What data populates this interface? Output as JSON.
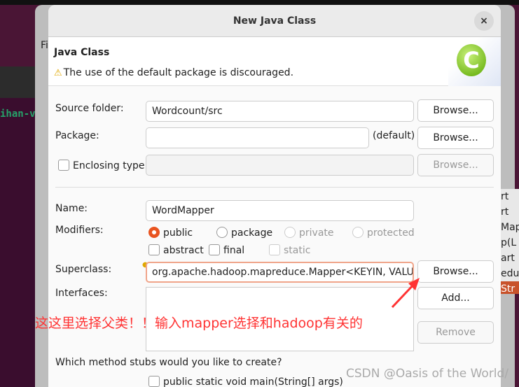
{
  "background": {
    "terminal_text": "ihan-v",
    "ide_right_lines": [
      "rt",
      "rt",
      "Map",
      "p(L",
      "art",
      "edu",
      "Str"
    ],
    "ide_menu": "Fi"
  },
  "dialog": {
    "title": "New Java Class",
    "close_label": "×",
    "banner": {
      "title": "Java Class",
      "warning": "The use of the default package is discouraged.",
      "icon": "java-class-c-icon",
      "icon_letter": "C"
    },
    "source_folder": {
      "label": "Source folder:",
      "value": "Wordcount/src",
      "browse": "Browse..."
    },
    "package": {
      "label": "Package:",
      "value": "",
      "hint": "(default)",
      "browse": "Browse..."
    },
    "enclosing": {
      "label": "Enclosing type:",
      "value": "",
      "checked": false,
      "browse": "Browse..."
    },
    "name": {
      "label": "Name:",
      "value": "WordMapper"
    },
    "modifiers": {
      "label": "Modifiers:",
      "access": [
        {
          "label": "public",
          "selected": true,
          "enabled": true
        },
        {
          "label": "package",
          "selected": false,
          "enabled": true
        },
        {
          "label": "private",
          "selected": false,
          "enabled": false
        },
        {
          "label": "protected",
          "selected": false,
          "enabled": false
        }
      ],
      "flags": [
        {
          "label": "abstract",
          "checked": false,
          "enabled": true
        },
        {
          "label": "final",
          "checked": false,
          "enabled": true
        },
        {
          "label": "static",
          "checked": false,
          "enabled": false
        }
      ]
    },
    "superclass": {
      "label": "Superclass:",
      "value": "org.apache.hadoop.mapreduce.Mapper<KEYIN, VALUE",
      "browse": "Browse..."
    },
    "interfaces": {
      "label": "Interfaces:",
      "add": "Add...",
      "remove": "Remove"
    },
    "stubs": {
      "question": "Which method stubs would you like to create?",
      "main": "public static void main(String[] args)"
    }
  },
  "annotation": {
    "text": "这这里选择父类！！输入mapper选择和hadoop有关的",
    "color": "#ff3333"
  },
  "watermark": "CSDN @Oasis of the World/",
  "colors": {
    "accent": "#e95420"
  }
}
